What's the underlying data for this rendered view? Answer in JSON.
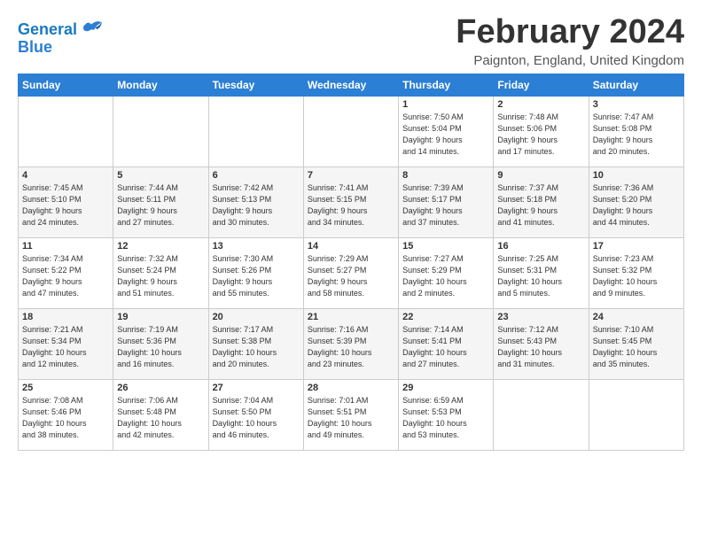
{
  "logo": {
    "line1": "General",
    "line2": "Blue"
  },
  "title": "February 2024",
  "location": "Paignton, England, United Kingdom",
  "days_of_week": [
    "Sunday",
    "Monday",
    "Tuesday",
    "Wednesday",
    "Thursday",
    "Friday",
    "Saturday"
  ],
  "weeks": [
    [
      {
        "day": "",
        "info": ""
      },
      {
        "day": "",
        "info": ""
      },
      {
        "day": "",
        "info": ""
      },
      {
        "day": "",
        "info": ""
      },
      {
        "day": "1",
        "info": "Sunrise: 7:50 AM\nSunset: 5:04 PM\nDaylight: 9 hours\nand 14 minutes."
      },
      {
        "day": "2",
        "info": "Sunrise: 7:48 AM\nSunset: 5:06 PM\nDaylight: 9 hours\nand 17 minutes."
      },
      {
        "day": "3",
        "info": "Sunrise: 7:47 AM\nSunset: 5:08 PM\nDaylight: 9 hours\nand 20 minutes."
      }
    ],
    [
      {
        "day": "4",
        "info": "Sunrise: 7:45 AM\nSunset: 5:10 PM\nDaylight: 9 hours\nand 24 minutes."
      },
      {
        "day": "5",
        "info": "Sunrise: 7:44 AM\nSunset: 5:11 PM\nDaylight: 9 hours\nand 27 minutes."
      },
      {
        "day": "6",
        "info": "Sunrise: 7:42 AM\nSunset: 5:13 PM\nDaylight: 9 hours\nand 30 minutes."
      },
      {
        "day": "7",
        "info": "Sunrise: 7:41 AM\nSunset: 5:15 PM\nDaylight: 9 hours\nand 34 minutes."
      },
      {
        "day": "8",
        "info": "Sunrise: 7:39 AM\nSunset: 5:17 PM\nDaylight: 9 hours\nand 37 minutes."
      },
      {
        "day": "9",
        "info": "Sunrise: 7:37 AM\nSunset: 5:18 PM\nDaylight: 9 hours\nand 41 minutes."
      },
      {
        "day": "10",
        "info": "Sunrise: 7:36 AM\nSunset: 5:20 PM\nDaylight: 9 hours\nand 44 minutes."
      }
    ],
    [
      {
        "day": "11",
        "info": "Sunrise: 7:34 AM\nSunset: 5:22 PM\nDaylight: 9 hours\nand 47 minutes."
      },
      {
        "day": "12",
        "info": "Sunrise: 7:32 AM\nSunset: 5:24 PM\nDaylight: 9 hours\nand 51 minutes."
      },
      {
        "day": "13",
        "info": "Sunrise: 7:30 AM\nSunset: 5:26 PM\nDaylight: 9 hours\nand 55 minutes."
      },
      {
        "day": "14",
        "info": "Sunrise: 7:29 AM\nSunset: 5:27 PM\nDaylight: 9 hours\nand 58 minutes."
      },
      {
        "day": "15",
        "info": "Sunrise: 7:27 AM\nSunset: 5:29 PM\nDaylight: 10 hours\nand 2 minutes."
      },
      {
        "day": "16",
        "info": "Sunrise: 7:25 AM\nSunset: 5:31 PM\nDaylight: 10 hours\nand 5 minutes."
      },
      {
        "day": "17",
        "info": "Sunrise: 7:23 AM\nSunset: 5:32 PM\nDaylight: 10 hours\nand 9 minutes."
      }
    ],
    [
      {
        "day": "18",
        "info": "Sunrise: 7:21 AM\nSunset: 5:34 PM\nDaylight: 10 hours\nand 12 minutes."
      },
      {
        "day": "19",
        "info": "Sunrise: 7:19 AM\nSunset: 5:36 PM\nDaylight: 10 hours\nand 16 minutes."
      },
      {
        "day": "20",
        "info": "Sunrise: 7:17 AM\nSunset: 5:38 PM\nDaylight: 10 hours\nand 20 minutes."
      },
      {
        "day": "21",
        "info": "Sunrise: 7:16 AM\nSunset: 5:39 PM\nDaylight: 10 hours\nand 23 minutes."
      },
      {
        "day": "22",
        "info": "Sunrise: 7:14 AM\nSunset: 5:41 PM\nDaylight: 10 hours\nand 27 minutes."
      },
      {
        "day": "23",
        "info": "Sunrise: 7:12 AM\nSunset: 5:43 PM\nDaylight: 10 hours\nand 31 minutes."
      },
      {
        "day": "24",
        "info": "Sunrise: 7:10 AM\nSunset: 5:45 PM\nDaylight: 10 hours\nand 35 minutes."
      }
    ],
    [
      {
        "day": "25",
        "info": "Sunrise: 7:08 AM\nSunset: 5:46 PM\nDaylight: 10 hours\nand 38 minutes."
      },
      {
        "day": "26",
        "info": "Sunrise: 7:06 AM\nSunset: 5:48 PM\nDaylight: 10 hours\nand 42 minutes."
      },
      {
        "day": "27",
        "info": "Sunrise: 7:04 AM\nSunset: 5:50 PM\nDaylight: 10 hours\nand 46 minutes."
      },
      {
        "day": "28",
        "info": "Sunrise: 7:01 AM\nSunset: 5:51 PM\nDaylight: 10 hours\nand 49 minutes."
      },
      {
        "day": "29",
        "info": "Sunrise: 6:59 AM\nSunset: 5:53 PM\nDaylight: 10 hours\nand 53 minutes."
      },
      {
        "day": "",
        "info": ""
      },
      {
        "day": "",
        "info": ""
      }
    ]
  ]
}
